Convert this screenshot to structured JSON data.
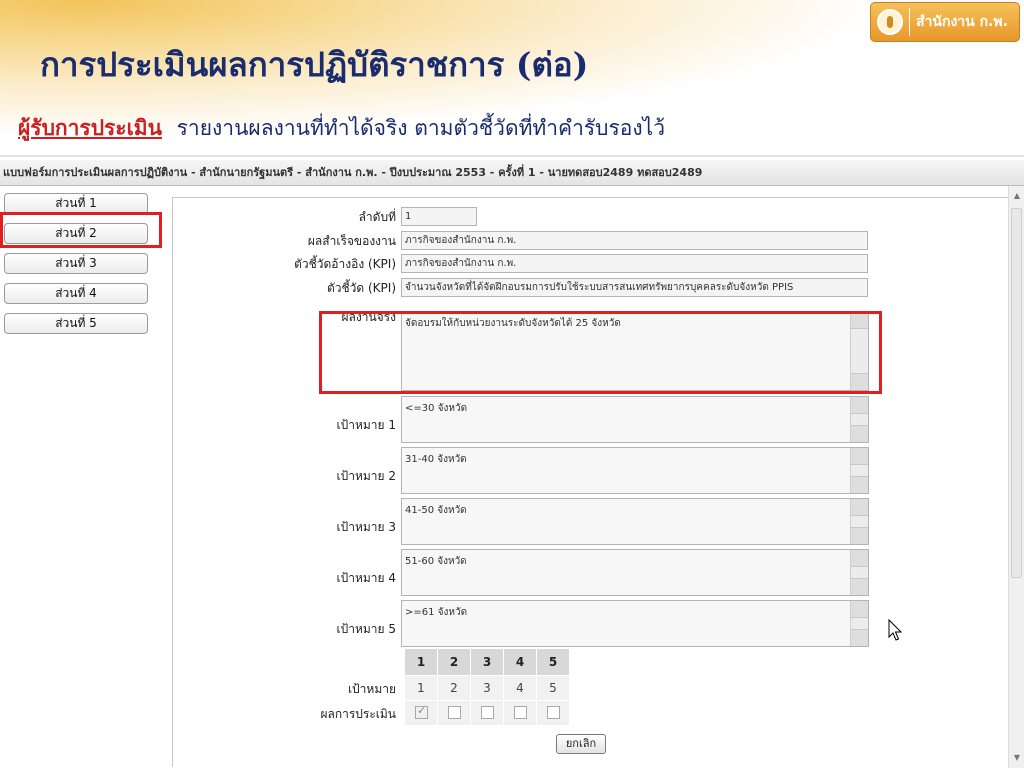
{
  "slide": {
    "title": "การประเมินผลการปฏิบัติราชการ (ต่อ)",
    "subtitle_emphasis": "ผู้รับการประเมิน",
    "subtitle_rest": "รายงานผลงานที่ทำได้จริง ตามตัวชี้วัดที่ทำคำรับรองไว้",
    "logo_text": "สำนักงาน ก.พ."
  },
  "form": {
    "title": "แบบฟอร์มการประเมินผลการปฏิบัติงาน - สำนักนายกรัฐมนตรี - สำนักงาน ก.พ. - ปีงบประมาณ 2553 - ครั้งที่ 1 - นายทดสอบ2489 ทดสอบ2489",
    "sections": [
      {
        "label": "ส่วนที่ 1",
        "selected": false
      },
      {
        "label": "ส่วนที่ 2",
        "selected": true
      },
      {
        "label": "ส่วนที่ 3",
        "selected": false
      },
      {
        "label": "ส่วนที่ 4",
        "selected": false
      },
      {
        "label": "ส่วนที่ 5",
        "selected": false
      }
    ],
    "fields": {
      "order_label": "ลำดับที่",
      "order_value": "1",
      "achievement_label": "ผลสำเร็จของงาน",
      "achievement_value": "ภารกิจของสำนักงาน ก.พ.",
      "kpi_ref_label": "ตัวชี้วัดอ้างอิง (KPI)",
      "kpi_ref_value": "ภารกิจของสำนักงาน ก.พ.",
      "kpi_label": "ตัวชี้วัด (KPI)",
      "kpi_value": "จำนวนจังหวัดที่ได้จัดฝึกอบรมการปรับใช้ระบบสารสนเทศทรัพยากรบุคคลระดับจังหวัด PPIS",
      "actual_label": "ผลงานจริง",
      "actual_value": "จัดอบรมให้กับหน่วยงานระดับจังหวัดได้ 25 จังหวัด"
    },
    "targets": [
      {
        "label": "เป้าหมาย 1",
        "value": "<=30 จังหวัด"
      },
      {
        "label": "เป้าหมาย 2",
        "value": "31-40 จังหวัด"
      },
      {
        "label": "เป้าหมาย 3",
        "value": "41-50 จังหวัด"
      },
      {
        "label": "เป้าหมาย 4",
        "value": "51-60 จังหวัด"
      },
      {
        "label": "เป้าหมาย 5",
        "value": ">=61 จังหวัด"
      }
    ],
    "grid": {
      "headers": [
        "1",
        "2",
        "3",
        "4",
        "5"
      ],
      "target_row_label": "เป้าหมาย",
      "target_values": [
        "1",
        "2",
        "3",
        "4",
        "5"
      ],
      "result_row_label": "ผลการประเมิน",
      "result_checked": [
        true,
        false,
        false,
        false,
        false
      ]
    },
    "cancel_label": "ยกเลิก"
  }
}
